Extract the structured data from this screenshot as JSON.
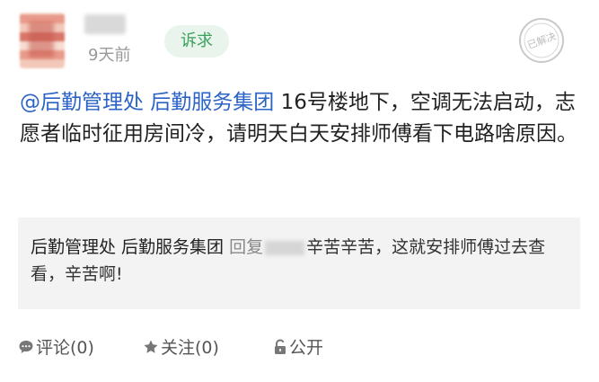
{
  "post": {
    "time_ago": "9天前",
    "tag": "诉求",
    "status_stamp": "已解决",
    "mention": "@后勤管理处 后勤服务集团",
    "body_text": " 16号楼地下，空调无法启动，志愿者临时征用房间冷，请明天白天安排师傅看下电路啥原因。"
  },
  "reply": {
    "author": "后勤管理处 后勤服务集团",
    "verb": " 回复",
    "text": "辛苦辛苦，这就安排师傅过去查看，辛苦啊!"
  },
  "actions": {
    "comment": "评论(0)",
    "follow": "关注(0)",
    "public": "公开"
  },
  "colors": {
    "mention": "#2b63c6",
    "tag_text": "#3aa15c",
    "tag_bg": "#e9f5ec",
    "reply_bg": "#f3f3f3"
  },
  "icons": [
    "comment-icon",
    "star-icon",
    "unlock-icon",
    "resolved-stamp-icon"
  ]
}
